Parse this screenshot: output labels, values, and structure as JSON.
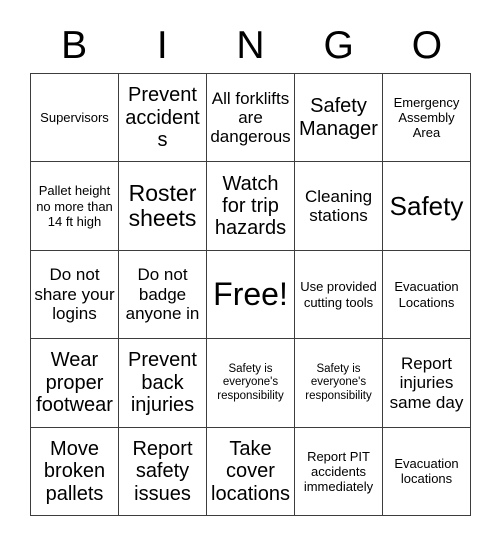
{
  "header": {
    "letters": [
      "B",
      "I",
      "N",
      "G",
      "O"
    ]
  },
  "grid": {
    "rows": [
      [
        {
          "text": "Supervisors",
          "size": "fs-sm"
        },
        {
          "text": "Prevent accidents",
          "size": "fs-lg"
        },
        {
          "text": "All forklifts are dangerous",
          "size": "fs-md"
        },
        {
          "text": "Safety Manager",
          "size": "fs-lg"
        },
        {
          "text": "Emergency Assembly Area",
          "size": "fs-sm"
        }
      ],
      [
        {
          "text": "Pallet height no more than 14 ft high",
          "size": "fs-sm"
        },
        {
          "text": "Roster sheets",
          "size": "fs-xl"
        },
        {
          "text": "Watch for trip hazards",
          "size": "fs-lg"
        },
        {
          "text": "Cleaning stations",
          "size": "fs-md"
        },
        {
          "text": "Safety",
          "size": "fs-xxl"
        }
      ],
      [
        {
          "text": "Do not share your logins",
          "size": "fs-md"
        },
        {
          "text": "Do not badge anyone in",
          "size": "fs-md"
        },
        {
          "text": "Free!",
          "size": "fs-free"
        },
        {
          "text": "Use provided cutting tools",
          "size": "fs-sm"
        },
        {
          "text": "Evacuation Locations",
          "size": "fs-sm"
        }
      ],
      [
        {
          "text": "Wear proper footwear",
          "size": "fs-lg"
        },
        {
          "text": "Prevent back injuries",
          "size": "fs-lg"
        },
        {
          "text": "Safety is everyone's responsibility",
          "size": "fs-xs"
        },
        {
          "text": "Safety is everyone's responsibility",
          "size": "fs-xs"
        },
        {
          "text": "Report injuries same day",
          "size": "fs-md"
        }
      ],
      [
        {
          "text": "Move broken pallets",
          "size": "fs-lg"
        },
        {
          "text": "Report safety issues",
          "size": "fs-lg"
        },
        {
          "text": "Take cover locations",
          "size": "fs-lg"
        },
        {
          "text": "Report PIT accidents immediately",
          "size": "fs-sm"
        },
        {
          "text": "Evacuation locations",
          "size": "fs-sm"
        }
      ]
    ]
  },
  "colors": {
    "border": "#3d3d3d",
    "text": "#000000",
    "background": "#ffffff"
  }
}
